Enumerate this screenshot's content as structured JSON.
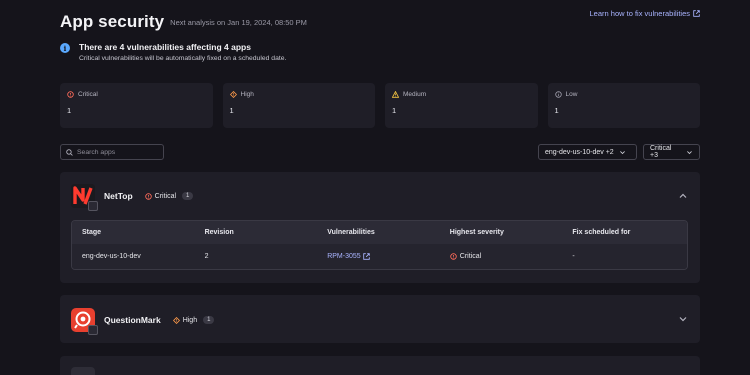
{
  "header": {
    "title": "App security",
    "subtitle": "Next analysis on Jan 19, 2024, 08:50 PM",
    "learn_link": "Learn how to fix vulnerabilities"
  },
  "banner": {
    "title": "There are 4 vulnerabilities affecting 4 apps",
    "subtitle": "Critical vulnerabilities will be automatically fixed on a scheduled date."
  },
  "summary_cards": [
    {
      "label": "Critical",
      "count": "1",
      "icon": "critical-circle-icon",
      "color": "#ff6b5a"
    },
    {
      "label": "High",
      "count": "1",
      "icon": "high-diamond-icon",
      "color": "#ff9a4a"
    },
    {
      "label": "Medium",
      "count": "1",
      "icon": "medium-triangle-icon",
      "color": "#f5c542"
    },
    {
      "label": "Low",
      "count": "1",
      "icon": "low-circle-icon",
      "color": "#9a99a6"
    }
  ],
  "search": {
    "placeholder": "Search apps",
    "value": ""
  },
  "filters": {
    "environment": "eng-dev-us-10-dev +2",
    "severity": "Critical +3"
  },
  "apps": [
    {
      "name": "NetTop",
      "severity": "Critical",
      "count": "1",
      "expanded": true,
      "table": {
        "columns": [
          "Stage",
          "Revision",
          "Vulnerabilities",
          "Highest severity",
          "Fix scheduled for"
        ],
        "rows": [
          {
            "stage": "eng-dev-us-10-dev",
            "revision": "2",
            "vulnerability": "RPM-3055",
            "severity": "Critical",
            "fix_scheduled": "-"
          }
        ]
      }
    },
    {
      "name": "QuestionMark",
      "severity": "High",
      "count": "1",
      "expanded": false
    }
  ],
  "colors": {
    "background": "#15141b",
    "panel": "#1f1e27",
    "link": "#a9b4ff",
    "critical": "#ff6b5a",
    "high": "#ff9a4a",
    "info": "#5aa9ff"
  }
}
